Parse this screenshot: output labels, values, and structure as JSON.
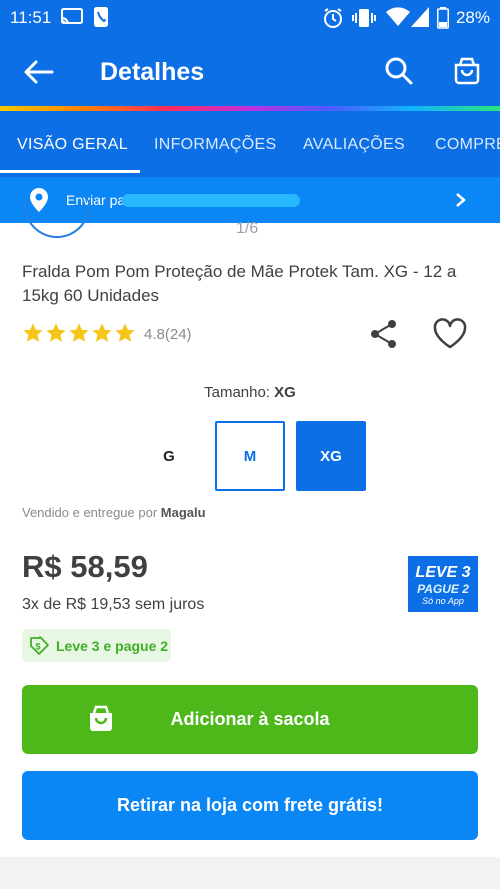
{
  "status_bar": {
    "time": "11:51",
    "battery": "28%"
  },
  "app_bar": {
    "title": "Detalhes"
  },
  "tabs": [
    {
      "label": "VISÃO GERAL",
      "active": true
    },
    {
      "label": "INFORMAÇÕES",
      "active": false
    },
    {
      "label": "AVALIAÇÕES",
      "active": false
    },
    {
      "label": "COMPRE",
      "active": false
    }
  ],
  "shipping": {
    "label": "Enviar pa"
  },
  "gallery": {
    "pager": "1/6"
  },
  "product": {
    "title": "Fralda Pom Pom Proteção de Mãe Protek Tam. XG - 12 a 15kg 60 Unidades",
    "rating_stars": 5,
    "rating_text": "4.8(24)"
  },
  "size": {
    "caption_label": "Tamanho:",
    "selected": "XG",
    "options": [
      "G",
      "M",
      "XG"
    ]
  },
  "seller": {
    "prefix": "Vendido e entregue por",
    "name": "Magalu"
  },
  "pricing": {
    "price": "R$ 58,59",
    "installment": "3x de R$ 19,53 sem juros"
  },
  "promo_badge": {
    "line1": "LEVE 3",
    "line2": "PAGUE 2",
    "line3": "Só no App"
  },
  "promo_tag": {
    "label": "Leve 3 e pague 2"
  },
  "buttons": {
    "add_to_bag": "Adicionar à sacola",
    "pickup": "Retirar na loja com frete grátis!"
  },
  "colors": {
    "primary_blue": "#0c6fe6",
    "ship_bar_blue": "#0b86f5",
    "cta_green": "#4eb81b",
    "star_yellow": "#f5c518",
    "promo_green": "#3fae29"
  }
}
